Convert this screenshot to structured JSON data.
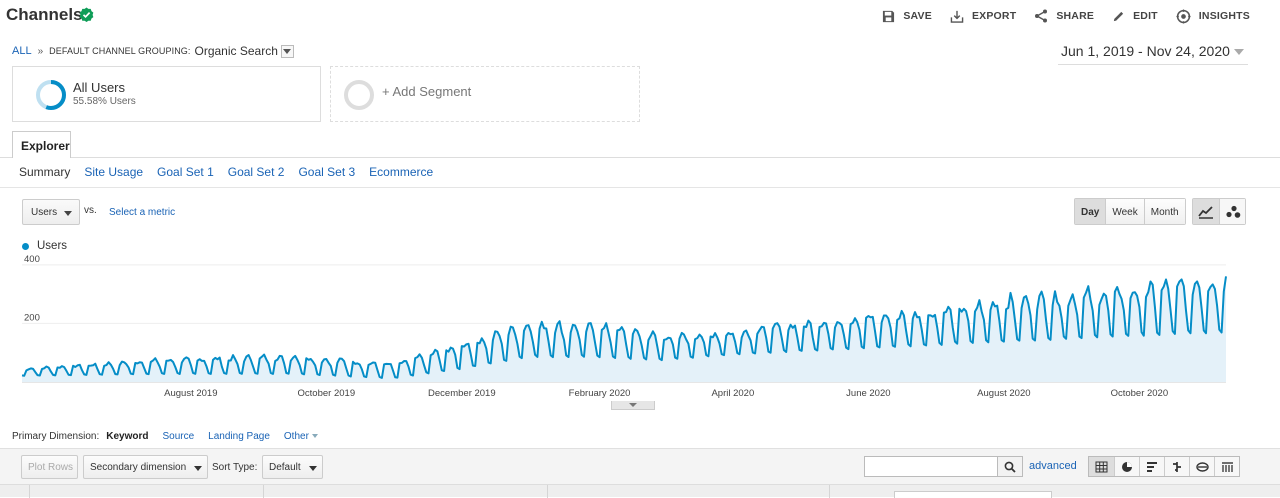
{
  "header": {
    "title": "Channels",
    "actions": [
      {
        "icon": "save-icon",
        "label": "SAVE"
      },
      {
        "icon": "export-icon",
        "label": "EXPORT"
      },
      {
        "icon": "share-icon",
        "label": "SHARE"
      },
      {
        "icon": "edit-icon",
        "label": "EDIT"
      },
      {
        "icon": "insights-icon",
        "label": "INSIGHTS"
      }
    ]
  },
  "breadcrumb": {
    "all": "ALL",
    "separator": "»",
    "dimension": "DEFAULT CHANNEL GROUPING:",
    "value": "Organic Search"
  },
  "date_range": "Jun 1, 2019 - Nov 24, 2020",
  "segments": {
    "active": {
      "name": "All Users",
      "subtitle": "55.58% Users",
      "fraction": 0.5558
    },
    "add_label": "+ Add Segment"
  },
  "explorer": {
    "tab": "Explorer",
    "subtabs": [
      "Summary",
      "Site Usage",
      "Goal Set 1",
      "Goal Set 2",
      "Goal Set 3",
      "Ecommerce"
    ],
    "active_subtab": "Summary"
  },
  "metric_controls": {
    "metric": "Users",
    "vs": "vs.",
    "select_metric": "Select a metric",
    "granularity": [
      "Day",
      "Week",
      "Month"
    ],
    "active_granularity": "Day"
  },
  "chart_data": {
    "type": "area",
    "series": [
      {
        "name": "Users",
        "color": "#058dc7"
      }
    ],
    "x_range": [
      "2019-06-01",
      "2020-11-24"
    ],
    "x_tick_labels": [
      "August 2019",
      "October 2019",
      "December 2019",
      "February 2020",
      "April 2020",
      "June 2020",
      "August 2020",
      "October 2020"
    ],
    "y_ticks": [
      200,
      400
    ],
    "ylim": [
      0,
      420
    ],
    "weekly_levels": [
      {
        "date": "2019-06-01",
        "low": 20,
        "high": 45
      },
      {
        "date": "2019-08-01",
        "low": 25,
        "high": 75
      },
      {
        "date": "2019-10-01",
        "low": 25,
        "high": 90
      },
      {
        "date": "2019-11-15",
        "low": 10,
        "high": 60
      },
      {
        "date": "2019-12-15",
        "low": 40,
        "high": 130
      },
      {
        "date": "2020-01-15",
        "low": 80,
        "high": 200
      },
      {
        "date": "2020-02-15",
        "low": 80,
        "high": 190
      },
      {
        "date": "2020-03-15",
        "low": 70,
        "high": 160
      },
      {
        "date": "2020-04-15",
        "low": 90,
        "high": 170
      },
      {
        "date": "2020-05-15",
        "low": 100,
        "high": 200
      },
      {
        "date": "2020-06-15",
        "low": 110,
        "high": 225
      },
      {
        "date": "2020-07-15",
        "low": 120,
        "high": 240
      },
      {
        "date": "2020-08-15",
        "low": 130,
        "high": 280
      },
      {
        "date": "2020-09-15",
        "low": 140,
        "high": 300
      },
      {
        "date": "2020-10-15",
        "low": 150,
        "high": 320
      },
      {
        "date": "2020-11-24",
        "low": 160,
        "high": 360
      }
    ],
    "grid": true,
    "legend_position": "top-left"
  },
  "dimensions": {
    "label": "Primary Dimension:",
    "items": [
      "Keyword",
      "Source",
      "Landing Page",
      "Other"
    ],
    "active": "Keyword"
  },
  "table_toolbar": {
    "plot_rows": "Plot Rows",
    "secondary_dimension": "Secondary dimension",
    "sort_type_label": "Sort Type:",
    "sort_type_value": "Default",
    "search_value": "",
    "advanced": "advanced"
  }
}
